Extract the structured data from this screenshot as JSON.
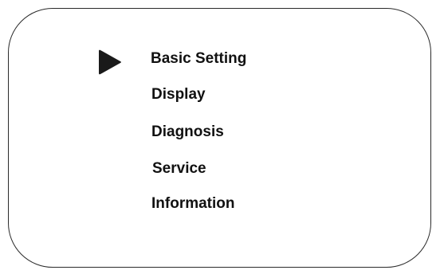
{
  "menu": {
    "items": [
      {
        "label": "Basic Setting",
        "selected": true
      },
      {
        "label": "Display",
        "selected": false
      },
      {
        "label": "Diagnosis",
        "selected": false
      },
      {
        "label": "Service",
        "selected": false
      },
      {
        "label": "Information",
        "selected": false
      }
    ]
  },
  "selector": {
    "icon": "triangle-pointer-icon",
    "color": "#1a1a1a"
  }
}
